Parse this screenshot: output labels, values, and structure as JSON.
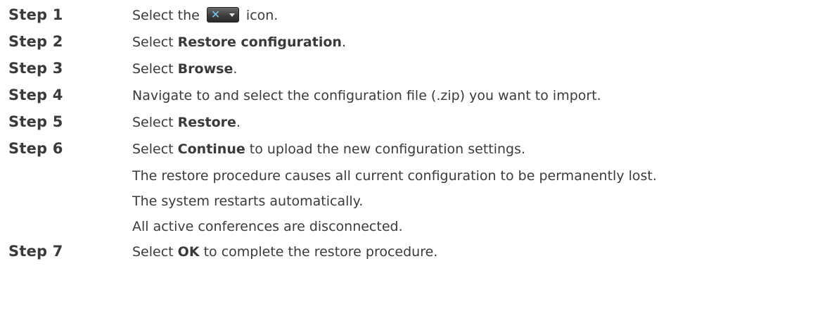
{
  "steps": [
    {
      "label": "Step 1",
      "pre": "Select the",
      "icon": "tools-dropdown-icon",
      "post": "icon."
    },
    {
      "label": "Step 2",
      "pre": "Select",
      "bold": "Restore configuration",
      "post": "."
    },
    {
      "label": "Step 3",
      "pre": "Select",
      "bold": "Browse",
      "post": "."
    },
    {
      "label": "Step 4",
      "text": "Navigate to and select the configuration file (.zip) you want to import."
    },
    {
      "label": "Step 5",
      "pre": "Select",
      "bold": "Restore",
      "post": "."
    },
    {
      "label": "Step 6",
      "pre": "Select",
      "bold": "Continue",
      "post": "to upload the new configuration settings."
    },
    {
      "label": "Step 7",
      "pre": "Select",
      "bold": "OK",
      "post": "to complete the restore procedure."
    }
  ],
  "step6_notes": [
    "The restore procedure causes all current configuration to be permanently lost.",
    "The system restarts automatically.",
    "All active conferences are disconnected."
  ]
}
